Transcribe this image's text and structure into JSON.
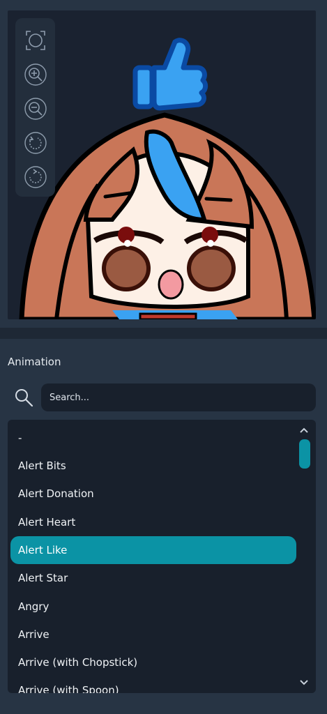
{
  "preview": {
    "toolbar": [
      {
        "name": "fit-view-icon"
      },
      {
        "name": "zoom-in-icon"
      },
      {
        "name": "zoom-out-icon"
      },
      {
        "name": "rotate-left-icon"
      },
      {
        "name": "reset-icon"
      }
    ]
  },
  "animation": {
    "section_label": "Animation",
    "search_placeholder": "Search...",
    "items": [
      {
        "label": "-"
      },
      {
        "label": "Alert Bits"
      },
      {
        "label": "Alert Donation"
      },
      {
        "label": "Alert Heart"
      },
      {
        "label": "Alert Like"
      },
      {
        "label": "Alert Star"
      },
      {
        "label": "Angry"
      },
      {
        "label": "Arrive"
      },
      {
        "label": "Arrive (with Chopstick)"
      },
      {
        "label": "Arrive (with Spoon)"
      }
    ],
    "selected": "Alert Like"
  },
  "colors": {
    "accent": "#0b93a5",
    "panel": "#18202c",
    "background": "#273444"
  }
}
